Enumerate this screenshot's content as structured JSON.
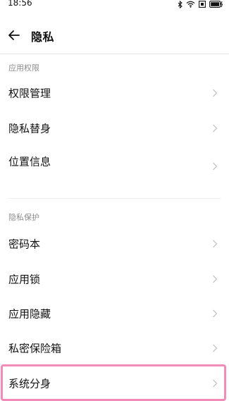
{
  "status_bar": {
    "time": "18:56",
    "icons": [
      "bluetooth-icon",
      "wifi-icon",
      "sim-icon",
      "battery-charging-icon"
    ]
  },
  "header": {
    "back_icon": "arrow-left-icon",
    "title": "隐私"
  },
  "sections": [
    {
      "label": "应用权限",
      "items": [
        {
          "label": "权限管理"
        },
        {
          "label": "隐私替身"
        },
        {
          "label": "位置信息"
        }
      ]
    },
    {
      "label": "隐私保护",
      "items": [
        {
          "label": "密码本"
        },
        {
          "label": "应用锁"
        },
        {
          "label": "应用隐藏"
        },
        {
          "label": "私密保险箱"
        },
        {
          "label": "系统分身"
        }
      ]
    }
  ],
  "colors": {
    "highlight": "#f28bb8",
    "section_label": "#8c8c8c",
    "chevron": "#c4c4c4"
  }
}
